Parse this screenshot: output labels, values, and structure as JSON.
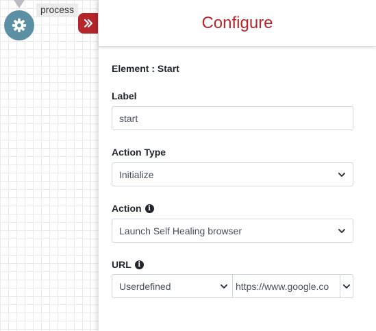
{
  "canvas": {
    "node_label": "process",
    "node_icon": "gear-icon"
  },
  "panel": {
    "title": "Configure",
    "collapse_icon": "double-chevron-right-icon",
    "element_title": "Element : Start",
    "label_field": {
      "label": "Label",
      "value": "start"
    },
    "action_type": {
      "label": "Action Type",
      "selected": "Initialize"
    },
    "action": {
      "label": "Action",
      "info_icon": "info-icon",
      "selected": "Launch Self Healing browser"
    },
    "url": {
      "label": "URL",
      "info_icon": "info-icon",
      "type_selected": "Userdefined",
      "value": "https://www.google.co"
    }
  },
  "colors": {
    "accent": "#b5262c",
    "node": "#5b8fa3",
    "border": "#ced4da"
  }
}
